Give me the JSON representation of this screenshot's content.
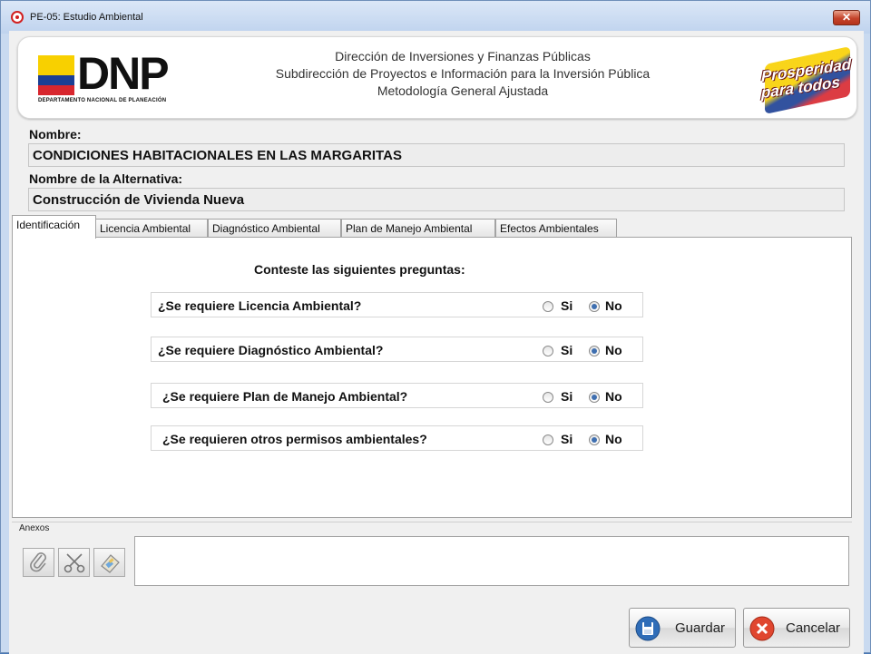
{
  "window": {
    "title": "PE-05: Estudio Ambiental",
    "close_label": "✕"
  },
  "banner": {
    "logo_text": "DNP",
    "logo_subtitle": "DEPARTAMENTO NACIONAL DE PLANEACIÓN",
    "line1": "Dirección de Inversiones y Finanzas Públicas",
    "line2": "Subdirección de Proyectos e Información para la Inversión Pública",
    "line3": "Metodología General Ajustada",
    "slogan_line1": "Prosperidad",
    "slogan_line2": "para todos"
  },
  "fields": {
    "nombre_label": "Nombre:",
    "nombre_value": "CONDICIONES HABITACIONALES EN LAS MARGARITAS",
    "alternativa_label": "Nombre de la Alternativa:",
    "alternativa_value": "Construcción de Vivienda Nueva"
  },
  "tabs": [
    {
      "label": "Identificación",
      "active": true
    },
    {
      "label": "Licencia Ambiental",
      "active": false
    },
    {
      "label": "Diagnóstico Ambiental",
      "active": false
    },
    {
      "label": "Plan de Manejo Ambiental",
      "active": false
    },
    {
      "label": "Efectos Ambientales",
      "active": false
    }
  ],
  "panel": {
    "prompt": "Conteste las siguientes preguntas:",
    "questions": [
      {
        "text": "¿Se requiere Licencia Ambiental?",
        "yes_label": "Si",
        "no_label": "No",
        "selected": "No"
      },
      {
        "text": "¿Se requiere Diagnóstico Ambiental?",
        "yes_label": "Si",
        "no_label": "No",
        "selected": "No"
      },
      {
        "text": "¿Se requiere Plan de Manejo Ambiental?",
        "yes_label": "Si",
        "no_label": "No",
        "selected": "No"
      },
      {
        "text": "¿Se requieren otros permisos ambientales?",
        "yes_label": "Si",
        "no_label": "No",
        "selected": "No"
      }
    ]
  },
  "anexos": {
    "label": "Anexos",
    "tools": [
      "paperclip-icon",
      "scissors-icon",
      "document-icon"
    ]
  },
  "actions": {
    "save_label": "Guardar",
    "cancel_label": "Cancelar"
  }
}
